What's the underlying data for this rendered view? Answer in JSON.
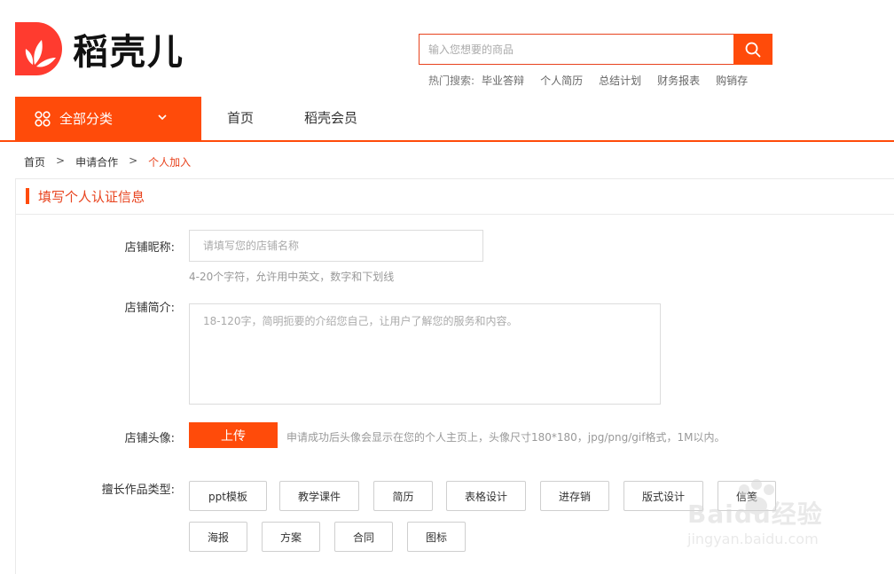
{
  "header": {
    "logo_text": "稻壳儿",
    "search_placeholder": "输入您想要的商品",
    "hot_label": "热门搜索:",
    "hot_items": [
      "毕业答辩",
      "个人简历",
      "总结计划",
      "财务报表",
      "购销存"
    ]
  },
  "nav": {
    "category_label": "全部分类",
    "links": [
      "首页",
      "稻壳会员"
    ]
  },
  "breadcrumb": {
    "items": [
      "首页",
      "申请合作",
      "个人加入"
    ],
    "separator": ">"
  },
  "form": {
    "title": "填写个人认证信息",
    "shop_name_label": "店铺昵称:",
    "shop_name_placeholder": "请填写您的店铺名称",
    "shop_name_hint": "4-20个字符，允许用中英文，数字和下划线",
    "shop_intro_label": "店铺简介:",
    "shop_intro_placeholder": "18-120字，简明扼要的介绍您自己，让用户了解您的服务和内容。",
    "avatar_label": "店铺头像:",
    "upload_label": "上传",
    "avatar_hint": "申请成功后头像会显示在您的个人主页上，头像尺寸180*180，jpg/png/gif格式，1M以内。",
    "work_type_label": "擅长作品类型:",
    "work_types": [
      "ppt模板",
      "教学课件",
      "简历",
      "表格设计",
      "进存销",
      "版式设计",
      "信笺",
      "海报",
      "方案",
      "合同",
      "图标"
    ]
  },
  "watermark": {
    "brand": "Baidu经验",
    "url": "jingyan.baidu.com"
  },
  "colors": {
    "accent": "#ff4b0a",
    "accent_text": "#e8431e"
  }
}
